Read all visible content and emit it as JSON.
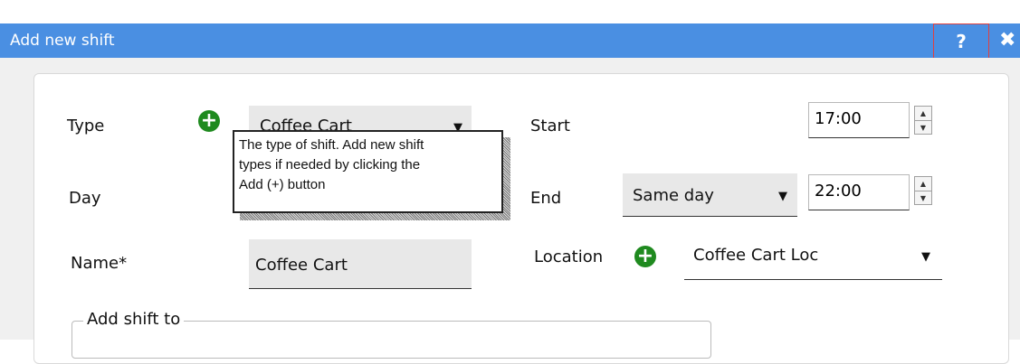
{
  "window": {
    "title": "Add new shift",
    "help_label": "?",
    "close_label": "✖"
  },
  "form": {
    "type": {
      "label": "Type",
      "add_label": "+",
      "value": "Coffee Cart"
    },
    "day": {
      "label": "Day"
    },
    "name": {
      "label": "Name*",
      "value": "Coffee Cart"
    },
    "start": {
      "label": "Start",
      "value": "17:00"
    },
    "end": {
      "label": "End",
      "day_value": "Same day",
      "time_value": "22:00"
    },
    "location": {
      "label": "Location",
      "add_label": "+",
      "value": "Coffee Cart Loc"
    },
    "add_shift_to": {
      "label": "Add shift to"
    }
  },
  "tooltip": {
    "text_line1": "The type of shift.  Add new shift",
    "text_line2": "types if needed by clicking the",
    "text_line3": "Add (+) button"
  },
  "icons": {
    "dropdown": "▼",
    "spin_up": "▲",
    "spin_down": "▼"
  },
  "colors": {
    "titlebar": "#4a8fe2",
    "add_button": "#1f8a1f",
    "help_highlight": "#e04040"
  }
}
